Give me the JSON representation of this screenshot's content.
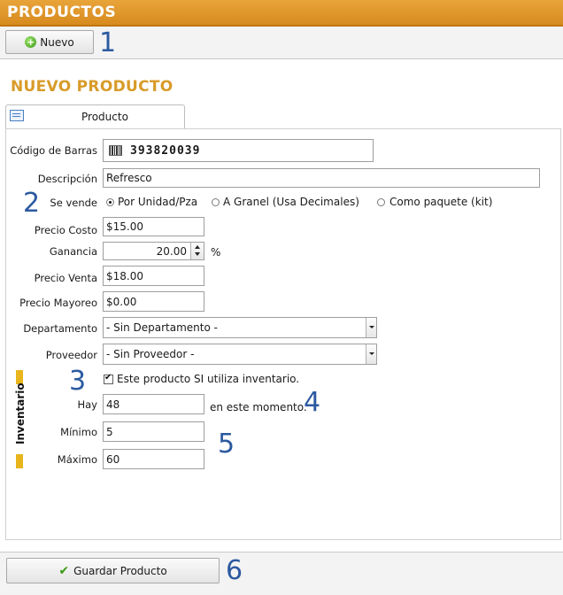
{
  "header": {
    "title": "PRODUCTOS"
  },
  "toolbar": {
    "new_label": "Nuevo"
  },
  "section": {
    "title": "NUEVO PRODUCTO"
  },
  "tab": {
    "label": "Producto"
  },
  "form": {
    "barcode_label": "Código de Barras",
    "barcode_value": "393820039",
    "description_label": "Descripción",
    "description_value": "Refresco",
    "sell_label": "Se vende",
    "sell_options": [
      "Por Unidad/Pza",
      "A Granel (Usa Decimales)",
      "Como paquete (kit)"
    ],
    "cost_label": "Precio Costo",
    "cost_value": "$15.00",
    "profit_label": "Ganancia",
    "profit_value": "20.00",
    "percent": "%",
    "sale_label": "Precio Venta",
    "sale_value": "$18.00",
    "wholesale_label": "Precio Mayoreo",
    "wholesale_value": "$0.00",
    "department_label": "Departamento",
    "department_value": "- Sin Departamento -",
    "supplier_label": "Proveedor",
    "supplier_value": "- Sin Proveedor -"
  },
  "inventory": {
    "section_label": "Inventario",
    "uses_inventory_label": "Este producto SI utiliza inventario.",
    "have_label": "Hay",
    "have_value": "48",
    "now_label": "en este momento.",
    "min_label": "Mínimo",
    "min_value": "5",
    "max_label": "Máximo",
    "max_value": "60"
  },
  "footer": {
    "save_label": "Guardar Producto"
  },
  "steps": [
    "1",
    "2",
    "3",
    "4",
    "5",
    "6"
  ],
  "colors": {
    "header": "#d88b1f",
    "section_title": "#d89b28",
    "step_numbers": "#2c5aa0",
    "inventory_bar": "#e8b51c"
  }
}
